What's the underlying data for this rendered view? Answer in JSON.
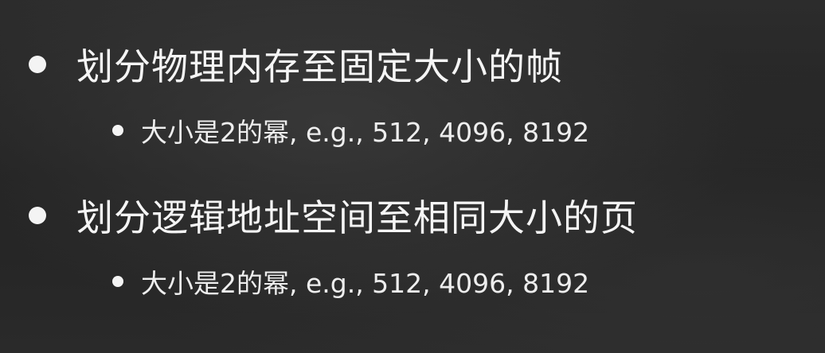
{
  "slide": {
    "points": [
      {
        "text": "划分物理内存至固定大小的帧",
        "sub": "大小是2的幂, e.g., 512, 4096, 8192"
      },
      {
        "text": "划分逻辑地址空间至相同大小的页",
        "sub": "大小是2的幂, e.g., 512, 4096, 8192"
      }
    ]
  },
  "colors": {
    "background": "#262626",
    "text": "#f5f5f5"
  }
}
